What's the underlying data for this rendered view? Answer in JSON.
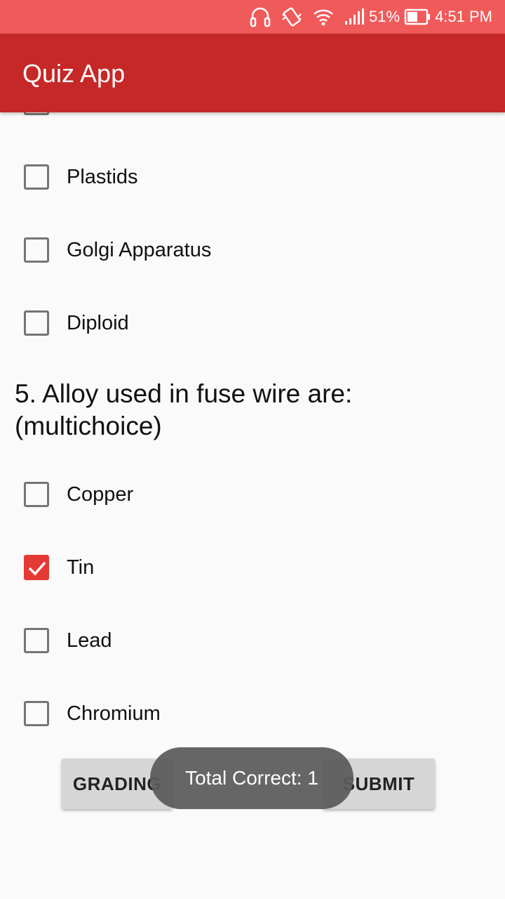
{
  "status_bar": {
    "battery_percent": "51%",
    "time": "4:51 PM",
    "icons": [
      "headphones-icon",
      "vibrate-icon",
      "wifi-icon",
      "signal-icon",
      "battery-icon"
    ]
  },
  "app_bar": {
    "title": "Quiz App"
  },
  "question4": {
    "options": [
      {
        "label": "Plastids",
        "checked": false
      },
      {
        "label": "Golgi Apparatus",
        "checked": false
      },
      {
        "label": "Diploid",
        "checked": false
      }
    ]
  },
  "question5": {
    "text": "5. Alloy used in fuse wire are: (multichoice)",
    "options": [
      {
        "label": "Copper",
        "checked": false
      },
      {
        "label": "Tin",
        "checked": true
      },
      {
        "label": "Lead",
        "checked": false
      },
      {
        "label": "Chromium",
        "checked": false
      }
    ]
  },
  "buttons": {
    "grading": "GRADING",
    "submit": "SUBMIT"
  },
  "toast": {
    "text": "Total Correct: 1"
  },
  "colors": {
    "status_bar": "#f15a5a",
    "app_bar": "#c62828",
    "checkbox_checked": "#e53935"
  }
}
